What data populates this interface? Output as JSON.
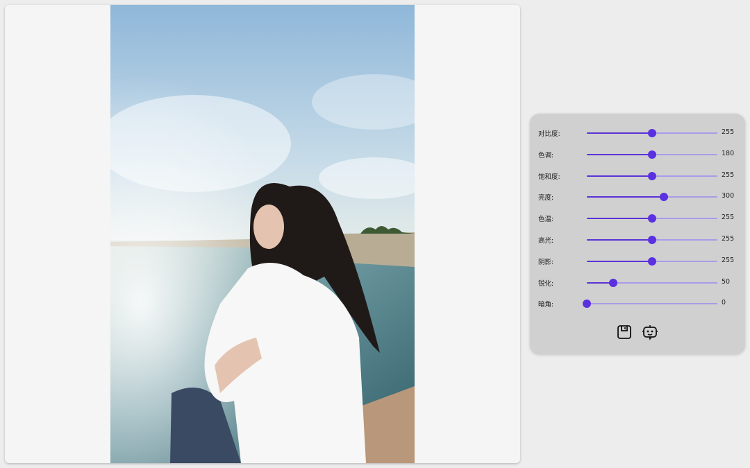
{
  "canvas": {
    "image_name": "photo-of-girl-by-sea"
  },
  "adjustments": [
    {
      "label": "对比度:",
      "value": "255",
      "fraction": 0.5
    },
    {
      "label": "色调:",
      "value": "180",
      "fraction": 0.5
    },
    {
      "label": "饱和度:",
      "value": "255",
      "fraction": 0.5
    },
    {
      "label": "亮度:",
      "value": "300",
      "fraction": 0.59
    },
    {
      "label": "色温:",
      "value": "255",
      "fraction": 0.5
    },
    {
      "label": "高光:",
      "value": "255",
      "fraction": 0.5
    },
    {
      "label": "阴影:",
      "value": "255",
      "fraction": 0.5
    },
    {
      "label": "锐化:",
      "value": "50",
      "fraction": 0.2
    },
    {
      "label": "暗角:",
      "value": "0",
      "fraction": 0.0
    }
  ],
  "actions": {
    "save_icon": "save-icon",
    "ai_icon": "robot-icon"
  },
  "colors": {
    "accent": "#5b30e0",
    "track": "#a99be8",
    "panel": "#d0d0d0"
  }
}
